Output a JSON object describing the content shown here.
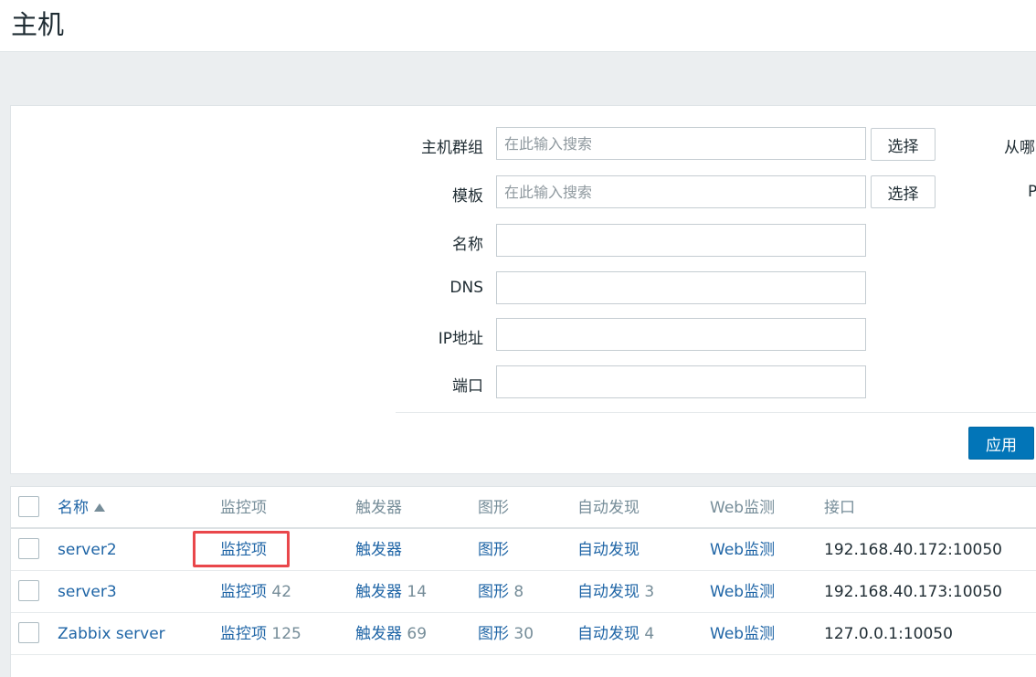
{
  "page": {
    "title": "主机"
  },
  "filter": {
    "host_groups": {
      "label": "主机群组",
      "placeholder": "在此输入搜索",
      "select": "选择"
    },
    "templates": {
      "label": "模板",
      "placeholder": "在此输入搜索",
      "select": "选择"
    },
    "name": {
      "label": "名称",
      "value": ""
    },
    "dns": {
      "label": "DNS",
      "value": ""
    },
    "ip": {
      "label": "IP地址",
      "value": ""
    },
    "port": {
      "label": "端口",
      "value": ""
    },
    "right_col_label_1": "从哪",
    "right_col_label_2": "P",
    "apply": "应用"
  },
  "table": {
    "columns": {
      "name": "名称",
      "items": "监控项",
      "triggers": "触发器",
      "graphs": "图形",
      "discovery": "自动发现",
      "web": "Web监测",
      "interface": "接口"
    },
    "rows": [
      {
        "name": "server2",
        "items": "监控项",
        "items_count": "",
        "triggers": "触发器",
        "triggers_count": "",
        "graphs": "图形",
        "graphs_count": "",
        "discovery": "自动发现",
        "discovery_count": "",
        "web": "Web监测",
        "interface": "192.168.40.172:10050"
      },
      {
        "name": "server3",
        "items": "监控项",
        "items_count": "42",
        "triggers": "触发器",
        "triggers_count": "14",
        "graphs": "图形",
        "graphs_count": "8",
        "discovery": "自动发现",
        "discovery_count": "3",
        "web": "Web监测",
        "interface": "192.168.40.173:10050"
      },
      {
        "name": "Zabbix server",
        "items": "监控项",
        "items_count": "125",
        "triggers": "触发器",
        "triggers_count": "69",
        "graphs": "图形",
        "graphs_count": "30",
        "discovery": "自动发现",
        "discovery_count": "4",
        "web": "Web监测",
        "interface": "127.0.0.1:10050"
      }
    ]
  },
  "colors": {
    "link": "#1f65a6",
    "apply_button": "#0275b8",
    "highlight": "#e9474b"
  }
}
